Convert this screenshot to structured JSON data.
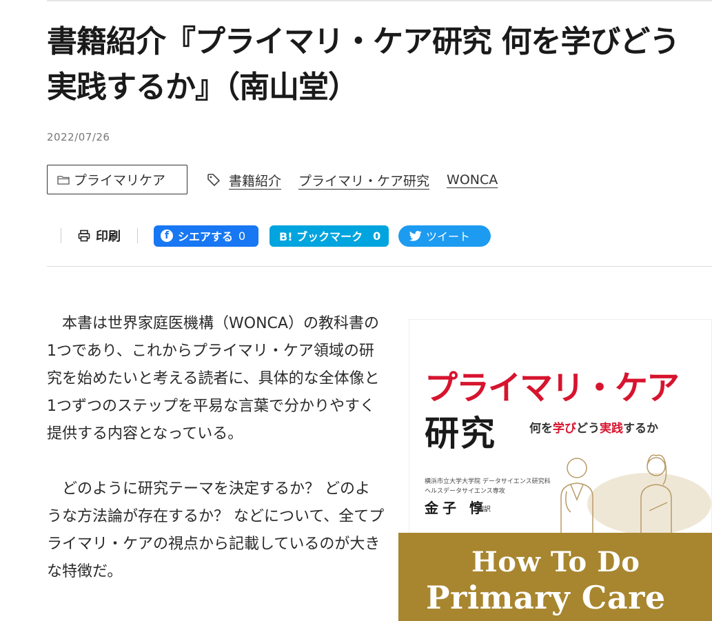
{
  "article": {
    "title": "書籍紹介『プライマリ・ケア研究 何を学びどう実践するか』（南山堂）",
    "date": "2022/07/26",
    "category": "プライマリケア",
    "tags": [
      "書籍紹介",
      "プライマリ・ケア研究",
      "WONCA"
    ]
  },
  "share": {
    "print_label": "印刷",
    "facebook_label": "シエアする",
    "facebook_count": "0",
    "hatena_label": "B! ブックマーク",
    "hatena_count": "0",
    "twitter_label": "ツイート"
  },
  "body": {
    "paragraphs": [
      "本書は世界家庭医機構（WONCA）の教科書の1つであり、これからプライマリ・ケア領域の研究を始めたいと考える読者に、具体的な全体像と1つずつのステップを平易な言葉で分かりやすく提供する内容となっている。",
      "どのように研究テーマを決定するか？ どのような方法論が存在するか？ などについて、全てプライマリ・ケアの視点から記載しているのが大きな特徴だ。"
    ]
  },
  "cover": {
    "title": "プライマリ・ケア",
    "title2": "研究",
    "subtitle_parts": [
      "何を",
      "学び",
      "どう",
      "実践",
      "するか"
    ],
    "affiliation1": "横浜市立大学大学院 データサイエンス研究科",
    "affiliation2": "ヘルスデータサイエンス専攻",
    "author": "金子 惇",
    "translator_role": "翻訳",
    "band_line1": "How To Do",
    "band_line2": "Primary Care"
  },
  "colors": {
    "facebook": "#1877f2",
    "hatena": "#00a4de",
    "twitter": "#1d9bf0",
    "cover_red": "#d7142e",
    "cover_band": "#a8862f"
  },
  "icons": {
    "category": "folder-icon",
    "tags": "tag-icon",
    "print": "printer-icon",
    "facebook": "facebook-icon",
    "twitter": "twitter-bird-icon"
  }
}
